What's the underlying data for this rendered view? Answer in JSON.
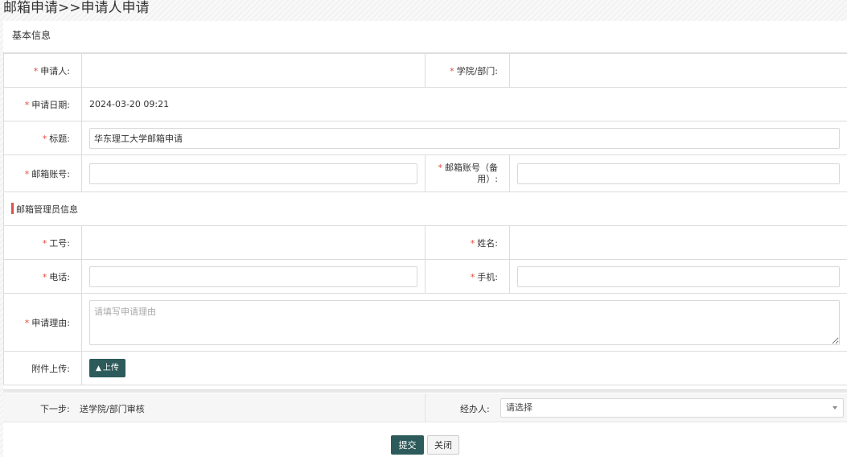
{
  "page": {
    "title": "邮箱申请>>申请人申请"
  },
  "section": {
    "basic_info": "基本信息",
    "admin_info": "邮箱管理员信息"
  },
  "fields": {
    "applicant_label": "申请人:",
    "dept_label": "学院/部门:",
    "date_label": "申请日期:",
    "date_value": "2024-03-20 09:21",
    "title_label": "标题:",
    "title_value": "华东理工大学邮箱申请",
    "email_label": "邮箱账号:",
    "email_backup_label": "邮箱账号（备用）:",
    "staff_no_label": "工号:",
    "name_label": "姓名:",
    "phone_label": "电话:",
    "mobile_label": "手机:",
    "reason_label": "申请理由:",
    "reason_placeholder": "请填写申请理由",
    "attachment_label": "附件上传:",
    "upload_button": "上传"
  },
  "required_mark": "*",
  "workflow": {
    "next_step_label": "下一步:",
    "next_step_value": "送学院/部门审核",
    "handler_label": "经办人:",
    "handler_value": "请选择"
  },
  "actions": {
    "submit": "提交",
    "close": "关闭"
  },
  "icons": {
    "upload": "user-upload-icon",
    "dropdown": "caret-down-icon"
  },
  "colors": {
    "primary": "#2d5a5a",
    "required": "#e04b3a",
    "section_bar": "#d9534f"
  }
}
